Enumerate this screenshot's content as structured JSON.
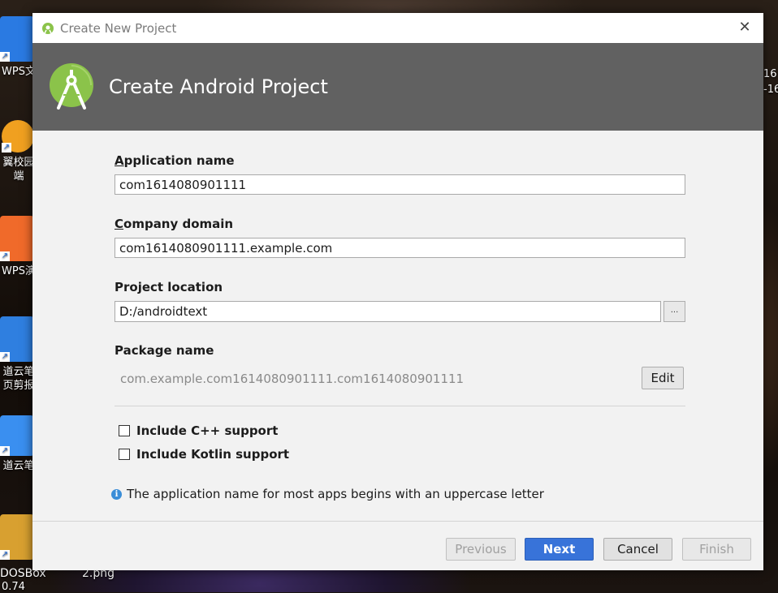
{
  "desktop": {
    "icons": [
      {
        "label1": "WPS文",
        "label2": "",
        "color": "#2a7ae2"
      },
      {
        "label1": "翼校园",
        "label2": "端",
        "color": "#f0a020"
      },
      {
        "label1": "WPS演",
        "label2": "",
        "color": "#f06a2a"
      },
      {
        "label1": "道云笔",
        "label2": "页剪报",
        "color": "#2f7fe0"
      },
      {
        "label1": "道云笔",
        "label2": "",
        "color": "#3a8ff0"
      },
      {
        "label1": "DOSBox",
        "label2": "0.74",
        "color": "#d8a030"
      }
    ],
    "right_fragment_line1": "16",
    "right_fragment_line2": "-16",
    "bottom_file_label": "2.png"
  },
  "dialog": {
    "window_title": "Create New Project",
    "heading": "Create Android Project",
    "fields": {
      "application_name": {
        "label_underlined": "A",
        "label_rest": "pplication name",
        "value": "com1614080901111"
      },
      "company_domain": {
        "label_underlined": "C",
        "label_rest": "ompany domain",
        "value": "com1614080901111.example.com"
      },
      "project_location": {
        "label": "Project location",
        "value": "D:/androidtext",
        "browse_label": "..."
      },
      "package_name": {
        "label": "Package name",
        "value": "com.example.com1614080901111.com1614080901111",
        "edit_label": "Edit"
      }
    },
    "checkboxes": [
      {
        "label": "Include C++ support",
        "checked": false
      },
      {
        "label": "Include Kotlin support",
        "checked": false
      }
    ],
    "info_text": "The application name for most apps begins with an uppercase letter",
    "buttons": {
      "previous": "Previous",
      "next": "Next",
      "cancel": "Cancel",
      "finish": "Finish"
    },
    "colors": {
      "header_bg": "#616161",
      "android_green": "#8bc34a",
      "primary_button": "#3873d9"
    }
  }
}
